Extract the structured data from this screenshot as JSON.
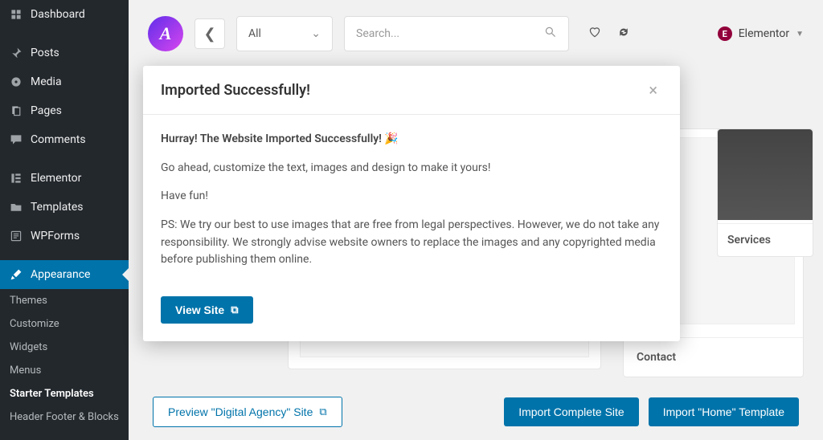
{
  "sidebar": {
    "items": [
      {
        "label": "Dashboard",
        "icon": "dashboard"
      },
      {
        "label": "Posts",
        "icon": "pin"
      },
      {
        "label": "Media",
        "icon": "media"
      },
      {
        "label": "Pages",
        "icon": "pages"
      },
      {
        "label": "Comments",
        "icon": "comments"
      },
      {
        "label": "Elementor",
        "icon": "elementor"
      },
      {
        "label": "Templates",
        "icon": "folder"
      },
      {
        "label": "WPForms",
        "icon": "wpforms"
      },
      {
        "label": "Appearance",
        "icon": "brush"
      }
    ],
    "sub_items": [
      {
        "label": "Themes"
      },
      {
        "label": "Customize"
      },
      {
        "label": "Widgets"
      },
      {
        "label": "Menus"
      },
      {
        "label": "Starter Templates",
        "current": true
      },
      {
        "label": "Header Footer & Blocks"
      }
    ]
  },
  "topbar": {
    "filter_label": "All",
    "search_placeholder": "Search...",
    "builder_label": "Elementor"
  },
  "cards": {
    "contact_label": "Contact",
    "services_label": "Services"
  },
  "bottom": {
    "preview_label": "Preview \"Digital Agency\" Site",
    "import_site_label": "Import Complete Site",
    "import_template_label": "Import \"Home\" Template"
  },
  "modal": {
    "title": "Imported Successfully!",
    "lead": "Hurray! The Website Imported Successfully! 🎉",
    "body1": "Go ahead, customize the text, images and design to make it yours!",
    "body2": "Have fun!",
    "body3": "PS: We try our best to use images that are free from legal perspectives. However, we do not take any responsibility. We strongly advise website owners to replace the images and any copyrighted media before publishing them online.",
    "cta": "View Site"
  }
}
